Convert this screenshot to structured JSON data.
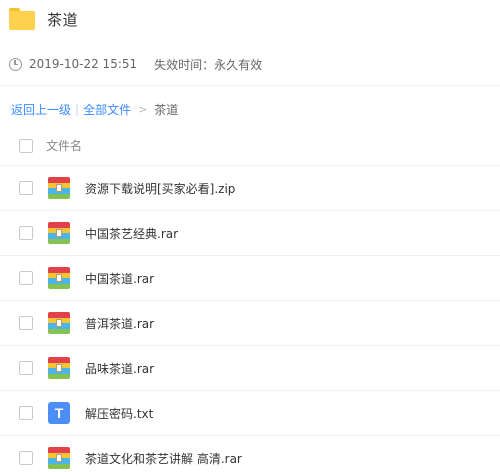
{
  "header": {
    "title": "茶道",
    "icon": "folder-icon"
  },
  "meta": {
    "timestamp": "2019-10-22 15:51",
    "expire": "失效时间：永久有效"
  },
  "breadcrumb": {
    "back": "返回上一级",
    "separator": "|",
    "all_files": "全部文件",
    "arrow": ">",
    "current": "茶道"
  },
  "list": {
    "column_header": "文件名",
    "files": [
      {
        "name": "资源下载说明[买家必看].zip",
        "type": "archive"
      },
      {
        "name": "中国茶艺经典.rar",
        "type": "archive"
      },
      {
        "name": "中国茶道.rar",
        "type": "archive"
      },
      {
        "name": "普洱茶道.rar",
        "type": "archive"
      },
      {
        "name": "品味茶道.rar",
        "type": "archive"
      },
      {
        "name": "解压密码.txt",
        "type": "text",
        "icon_letter": "T"
      },
      {
        "name": "茶道文化和茶艺讲解 高清.rar",
        "type": "archive"
      }
    ]
  },
  "colors": {
    "link": "#3b8cff",
    "folder": "#ffd24d",
    "txt_icon": "#4c8df6"
  }
}
